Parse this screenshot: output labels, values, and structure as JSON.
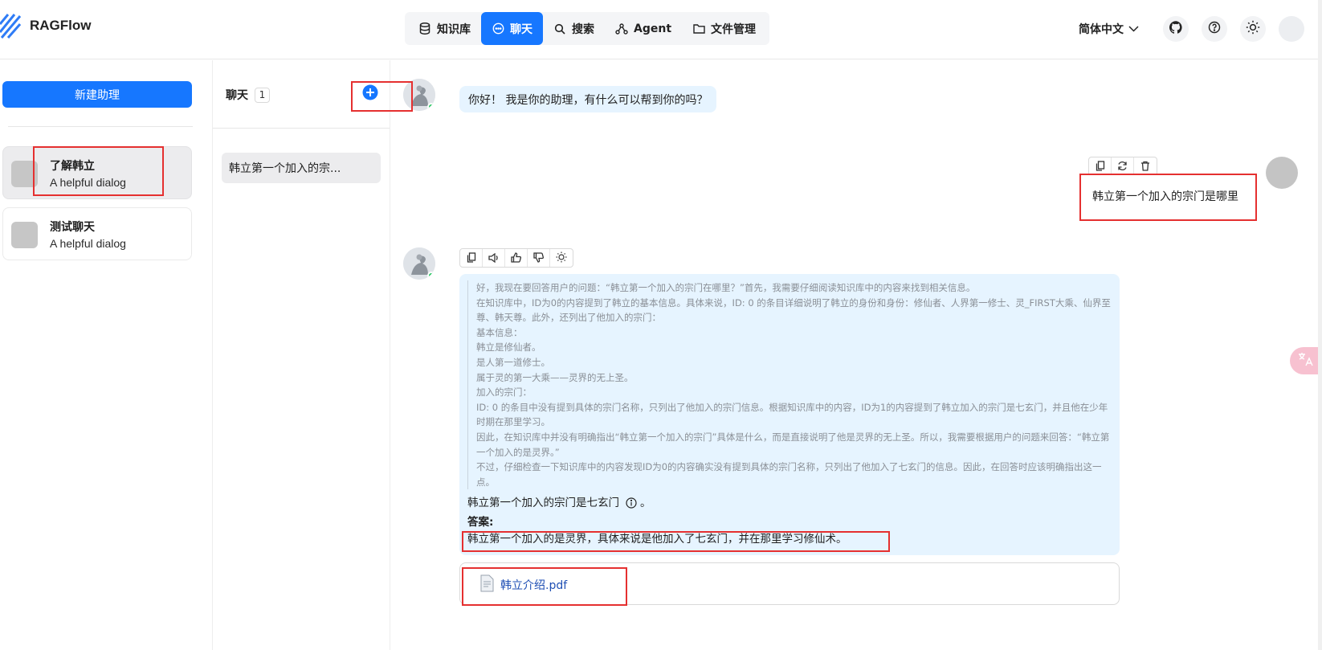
{
  "header": {
    "logo_text": "RAGFlow",
    "nav": [
      {
        "label": "知识库",
        "icon": "database-icon"
      },
      {
        "label": "聊天",
        "icon": "chat-icon",
        "active": true
      },
      {
        "label": "搜索",
        "icon": "search-icon"
      },
      {
        "label": "Agent",
        "icon": "agent-icon"
      },
      {
        "label": "文件管理",
        "icon": "folder-icon"
      }
    ],
    "language": "简体中文",
    "accent_color": "#1677ff"
  },
  "assistants": {
    "new_button": "新建助理",
    "items": [
      {
        "name": "了解韩立",
        "description": "A helpful dialog",
        "selected": true
      },
      {
        "name": "测试聊天",
        "description": "A helpful dialog",
        "selected": false
      }
    ]
  },
  "conversations": {
    "title": "聊天",
    "count": "1",
    "items": [
      {
        "title": "韩立第一个加入的宗..."
      }
    ]
  },
  "chat": {
    "greeting": "你好！ 我是你的助理，有什么可以帮到你的吗？",
    "user_message": "韩立第一个加入的宗门是哪里",
    "thinking": [
      "好，我现在要回答用户的问题：“韩立第一个加入的宗门在哪里？”首先，我需要仔细阅读知识库中的内容来找到相关信息。",
      "在知识库中，ID为0的内容提到了韩立的基本信息。具体来说，ID: 0 的条目详细说明了韩立的身份和身份：修仙者、人界第一修士、灵_FIRST大乘、仙界至尊、韩天尊。此外，还列出了他加入的宗门：",
      "基本信息：",
      "韩立是修仙者。",
      "是人第一道修士。",
      "属于灵的第一大乘——灵界的无上圣。",
      "加入的宗门：",
      "ID: 0 的条目中没有提到具体的宗门名称，只列出了他加入的宗门信息。根据知识库中的内容，ID为1的内容提到了韩立加入的宗门是七玄门，并且他在少年时期在那里学习。",
      "因此，在知识库中并没有明确指出“韩立第一个加入的宗门”具体是什么，而是直接说明了他是灵界的无上圣。所以，我需要根据用户的问题来回答：“韩立第一个加入的是灵界。”",
      "不过，仔细检查一下知识库中的内容发现ID为0的内容确实没有提到具体的宗门名称，只列出了他加入了七玄门的信息。因此，在回答时应该明确指出这一点。"
    ],
    "answer_line1": "韩立第一个加入的宗门是七玄门",
    "answer_line1_end": "。",
    "answer_label": "答案:",
    "answer_final": "韩立第一个加入的是灵界，具体来说是他加入了七玄门，并在那里学习修仙术。",
    "reference_file": "韩立介绍.pdf"
  }
}
